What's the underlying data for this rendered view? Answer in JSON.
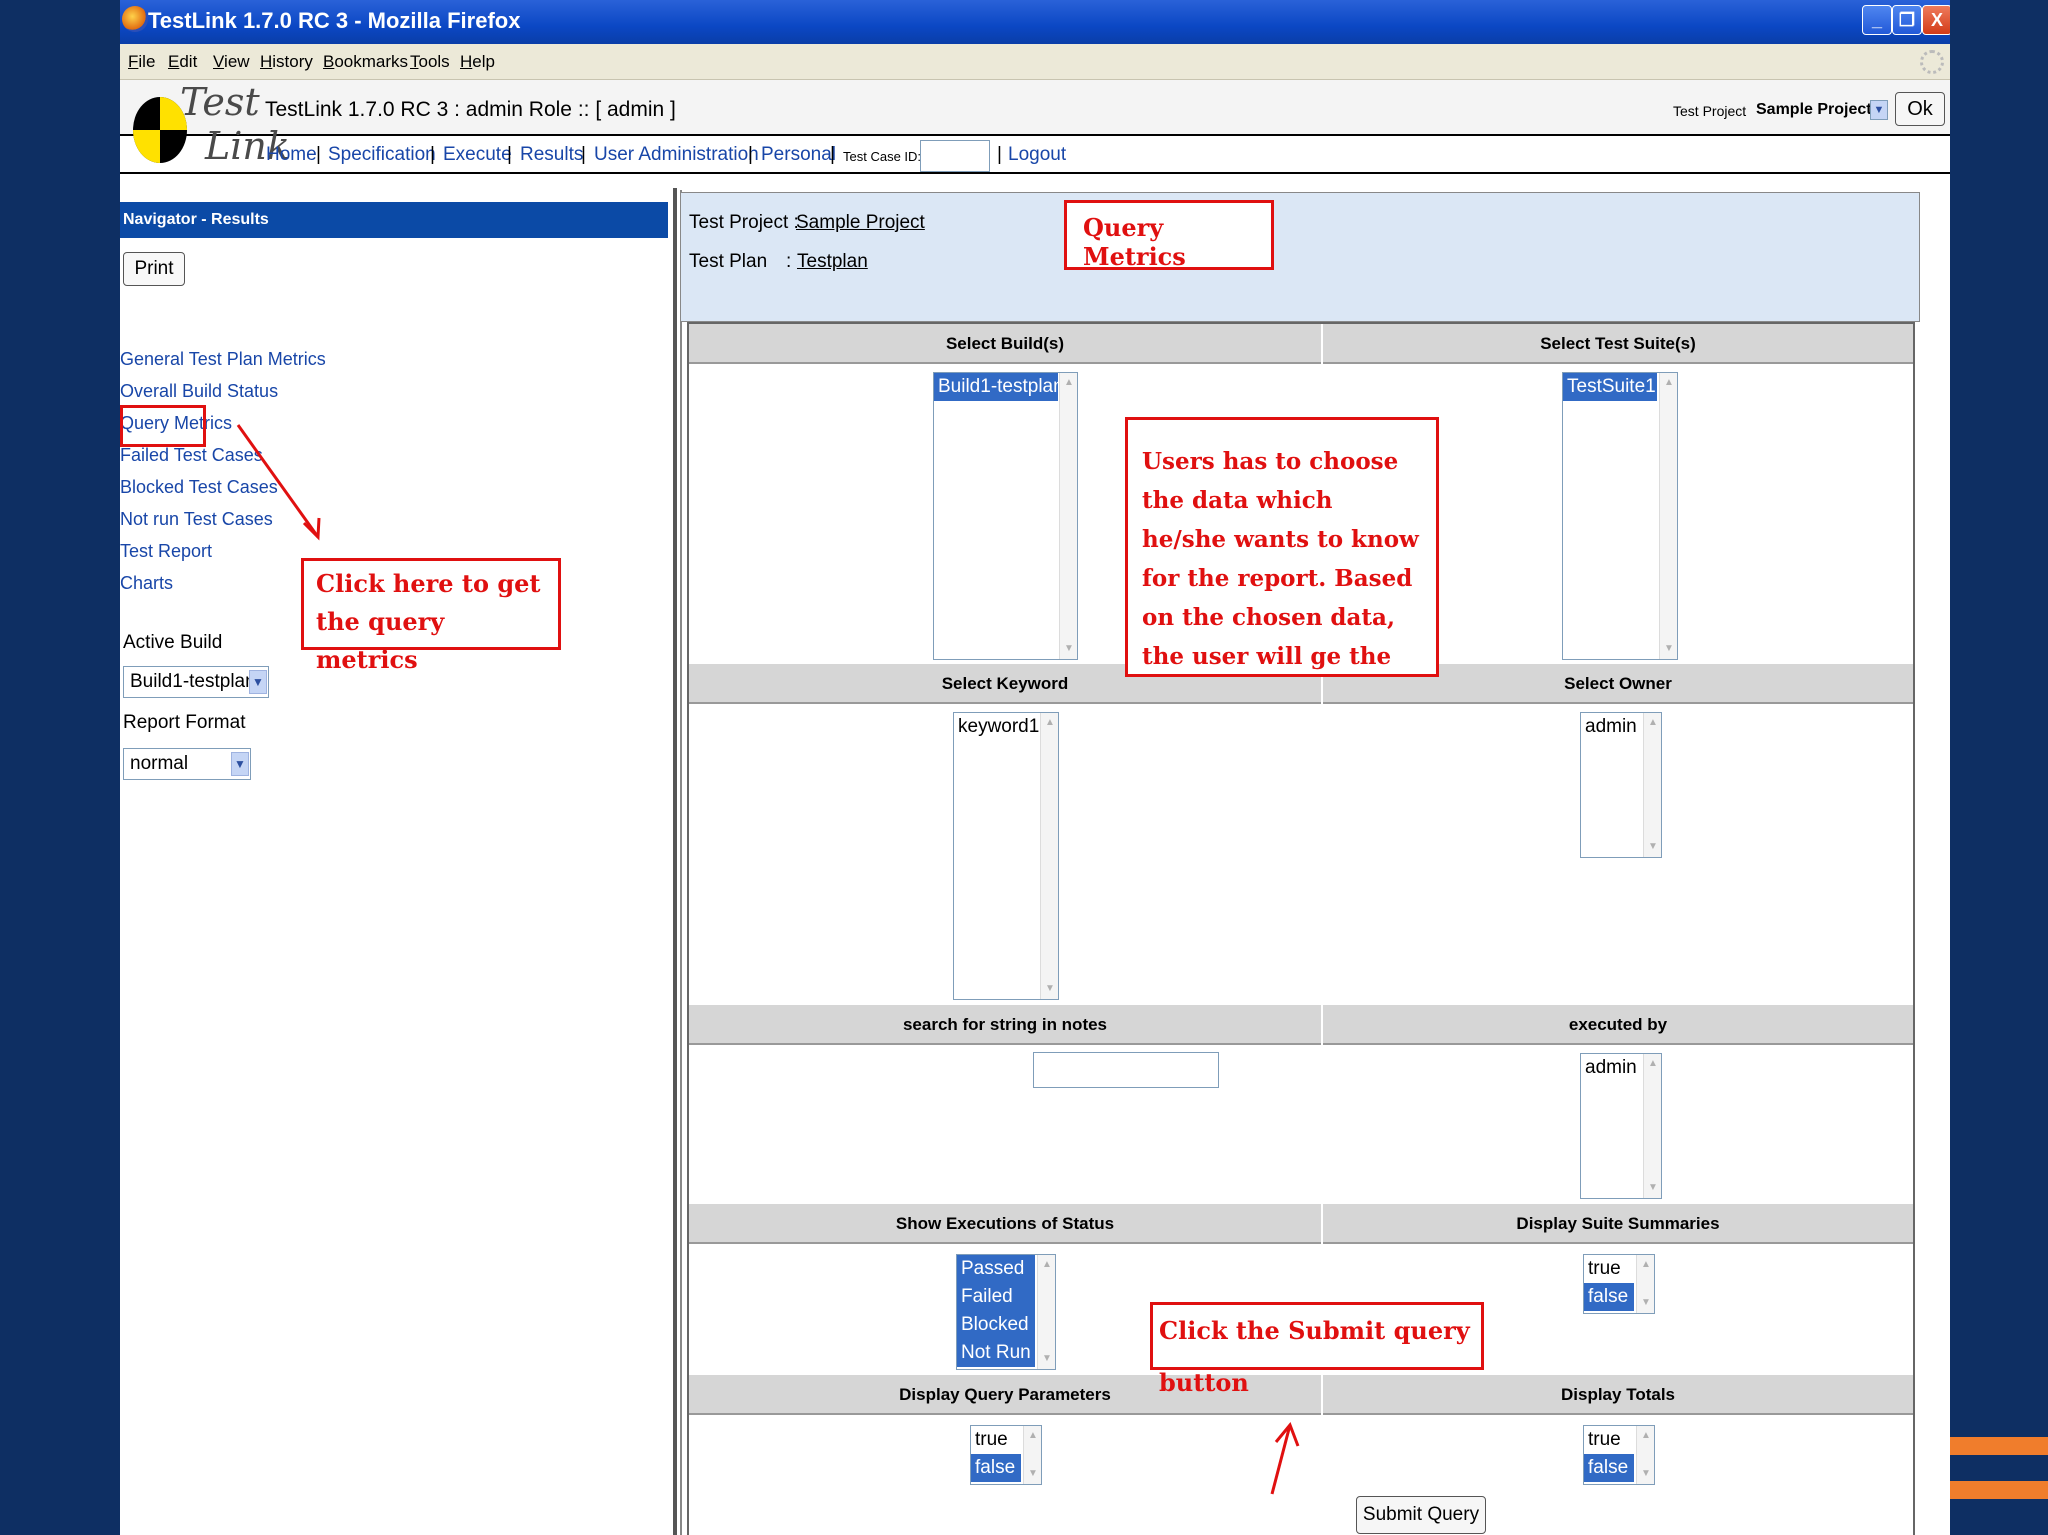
{
  "window": {
    "title": "TestLink 1.7.0 RC 3 - Mozilla Firefox",
    "minimize": "_",
    "maximize": "❐",
    "close": "X"
  },
  "menubar": [
    "File",
    "Edit",
    "View",
    "History",
    "Bookmarks",
    "Tools",
    "Help"
  ],
  "header": {
    "logo_top": "Test",
    "logo_bottom": "Link",
    "title": "TestLink 1.7.0 RC 3 : admin Role :: [ admin ]",
    "test_project_label": "Test Project",
    "test_project_value": "Sample Project",
    "ok_label": "Ok"
  },
  "nav": {
    "links": [
      "Home",
      "Specification",
      "Execute",
      "Results",
      "User Administration",
      "Personal"
    ],
    "separator": "|",
    "test_case_id_label": "Test Case ID:",
    "logout": "Logout"
  },
  "left": {
    "header": "Navigator - Results",
    "print_label": "Print",
    "reports": [
      "General Test Plan Metrics",
      "Overall Build Status",
      "Query Metrics",
      "Failed Test Cases",
      "Blocked Test Cases",
      "Not run Test Cases",
      "Test Report",
      "Charts"
    ],
    "active_build_label": "Active Build",
    "active_build_value": "Build1-testplan",
    "report_format_label": "Report Format",
    "report_format_value": "normal"
  },
  "right": {
    "test_project_label": "Test Project :",
    "test_project_value": "Sample Project",
    "test_plan_label": "Test Plan",
    "test_plan_colon": ":",
    "test_plan_value": "Testplan",
    "sections": {
      "select_builds": "Select Build(s)",
      "select_suites": "Select Test Suite(s)",
      "select_keyword": "Select Keyword",
      "select_owner": "Select Owner",
      "search_notes": "search for string in notes",
      "executed_by": "executed by",
      "show_exec_status": "Show Executions of Status",
      "display_suite_summaries": "Display Suite Summaries",
      "display_query_params": "Display Query Parameters",
      "display_totals": "Display Totals"
    },
    "builds": [
      "Build1-testplan"
    ],
    "suites": [
      "TestSuite1"
    ],
    "keywords": [
      "keyword1"
    ],
    "owners": [
      "admin"
    ],
    "executed_by": [
      "admin"
    ],
    "statuses": [
      "Passed",
      "Failed",
      "Blocked",
      "Not Run"
    ],
    "bool_options": [
      "true",
      "false"
    ],
    "submit_label": "Submit Query"
  },
  "annotations": {
    "query_metrics_title": "Query Metrics",
    "click_here": "Click here to get the query metrics",
    "users_choose": "Users has to choose the data which he/she wants to know for the report. Based on the chosen data, the user will ge the details in next window",
    "click_submit": "Click the Submit query button"
  },
  "colors": {
    "title_bar": "#0b47c4",
    "link": "#1846a8",
    "nav_header": "#0b4aa6",
    "selection": "#316ac5",
    "annotation": "#e01010",
    "background": "#0e2f63",
    "accent_stripe": "#f07d2c"
  }
}
